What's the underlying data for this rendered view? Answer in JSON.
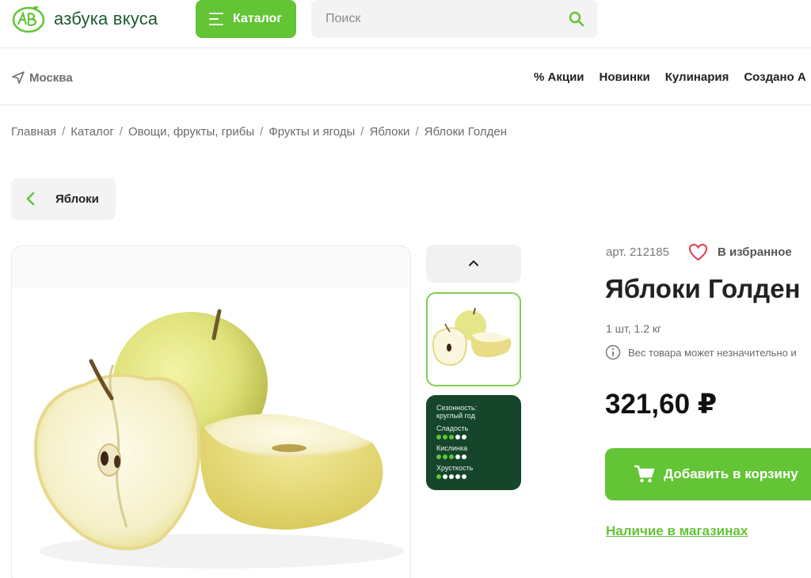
{
  "header": {
    "logo_text": "азбука вкуса",
    "catalog_label": "Каталог",
    "search_placeholder": "Поиск"
  },
  "navbar": {
    "city": "Москва",
    "links": [
      "% Акции",
      "Новинки",
      "Кулинария",
      "Создано А"
    ]
  },
  "breadcrumb": [
    "Главная",
    "Каталог",
    "Овощи, фрукты, грибы",
    "Фрукты и ягоды",
    "Яблоки",
    "Яблоки Голден"
  ],
  "back_button": {
    "label": "Яблоки"
  },
  "gallery": {
    "main_image_icon": "golden-apples-photo",
    "thumbnail_card": {
      "seasonality_label": "Сезонность:",
      "seasonality_value": "круглый год",
      "sweetness_label": "Сладость",
      "sweetness_level": 3,
      "acidity_label": "Кислинка",
      "acidity_level": 3,
      "crunch_label": "Хрусткость",
      "crunch_level": 1,
      "scale_max": 5
    }
  },
  "product": {
    "article": "арт. 212185",
    "favorite_label": "В избранное",
    "title": "Яблоки Голден",
    "weight": "1 шт, 1.2 кг",
    "notice": "Вес товара может незначительно и",
    "price": "321,60 ₽",
    "add_to_cart_label": "Добавить в корзину",
    "stores_link": "Наличие в магазинах"
  },
  "colors": {
    "accent_green": "#63c436",
    "brand_dark_green": "#1e5a33",
    "card_dark_green": "#15452a"
  }
}
